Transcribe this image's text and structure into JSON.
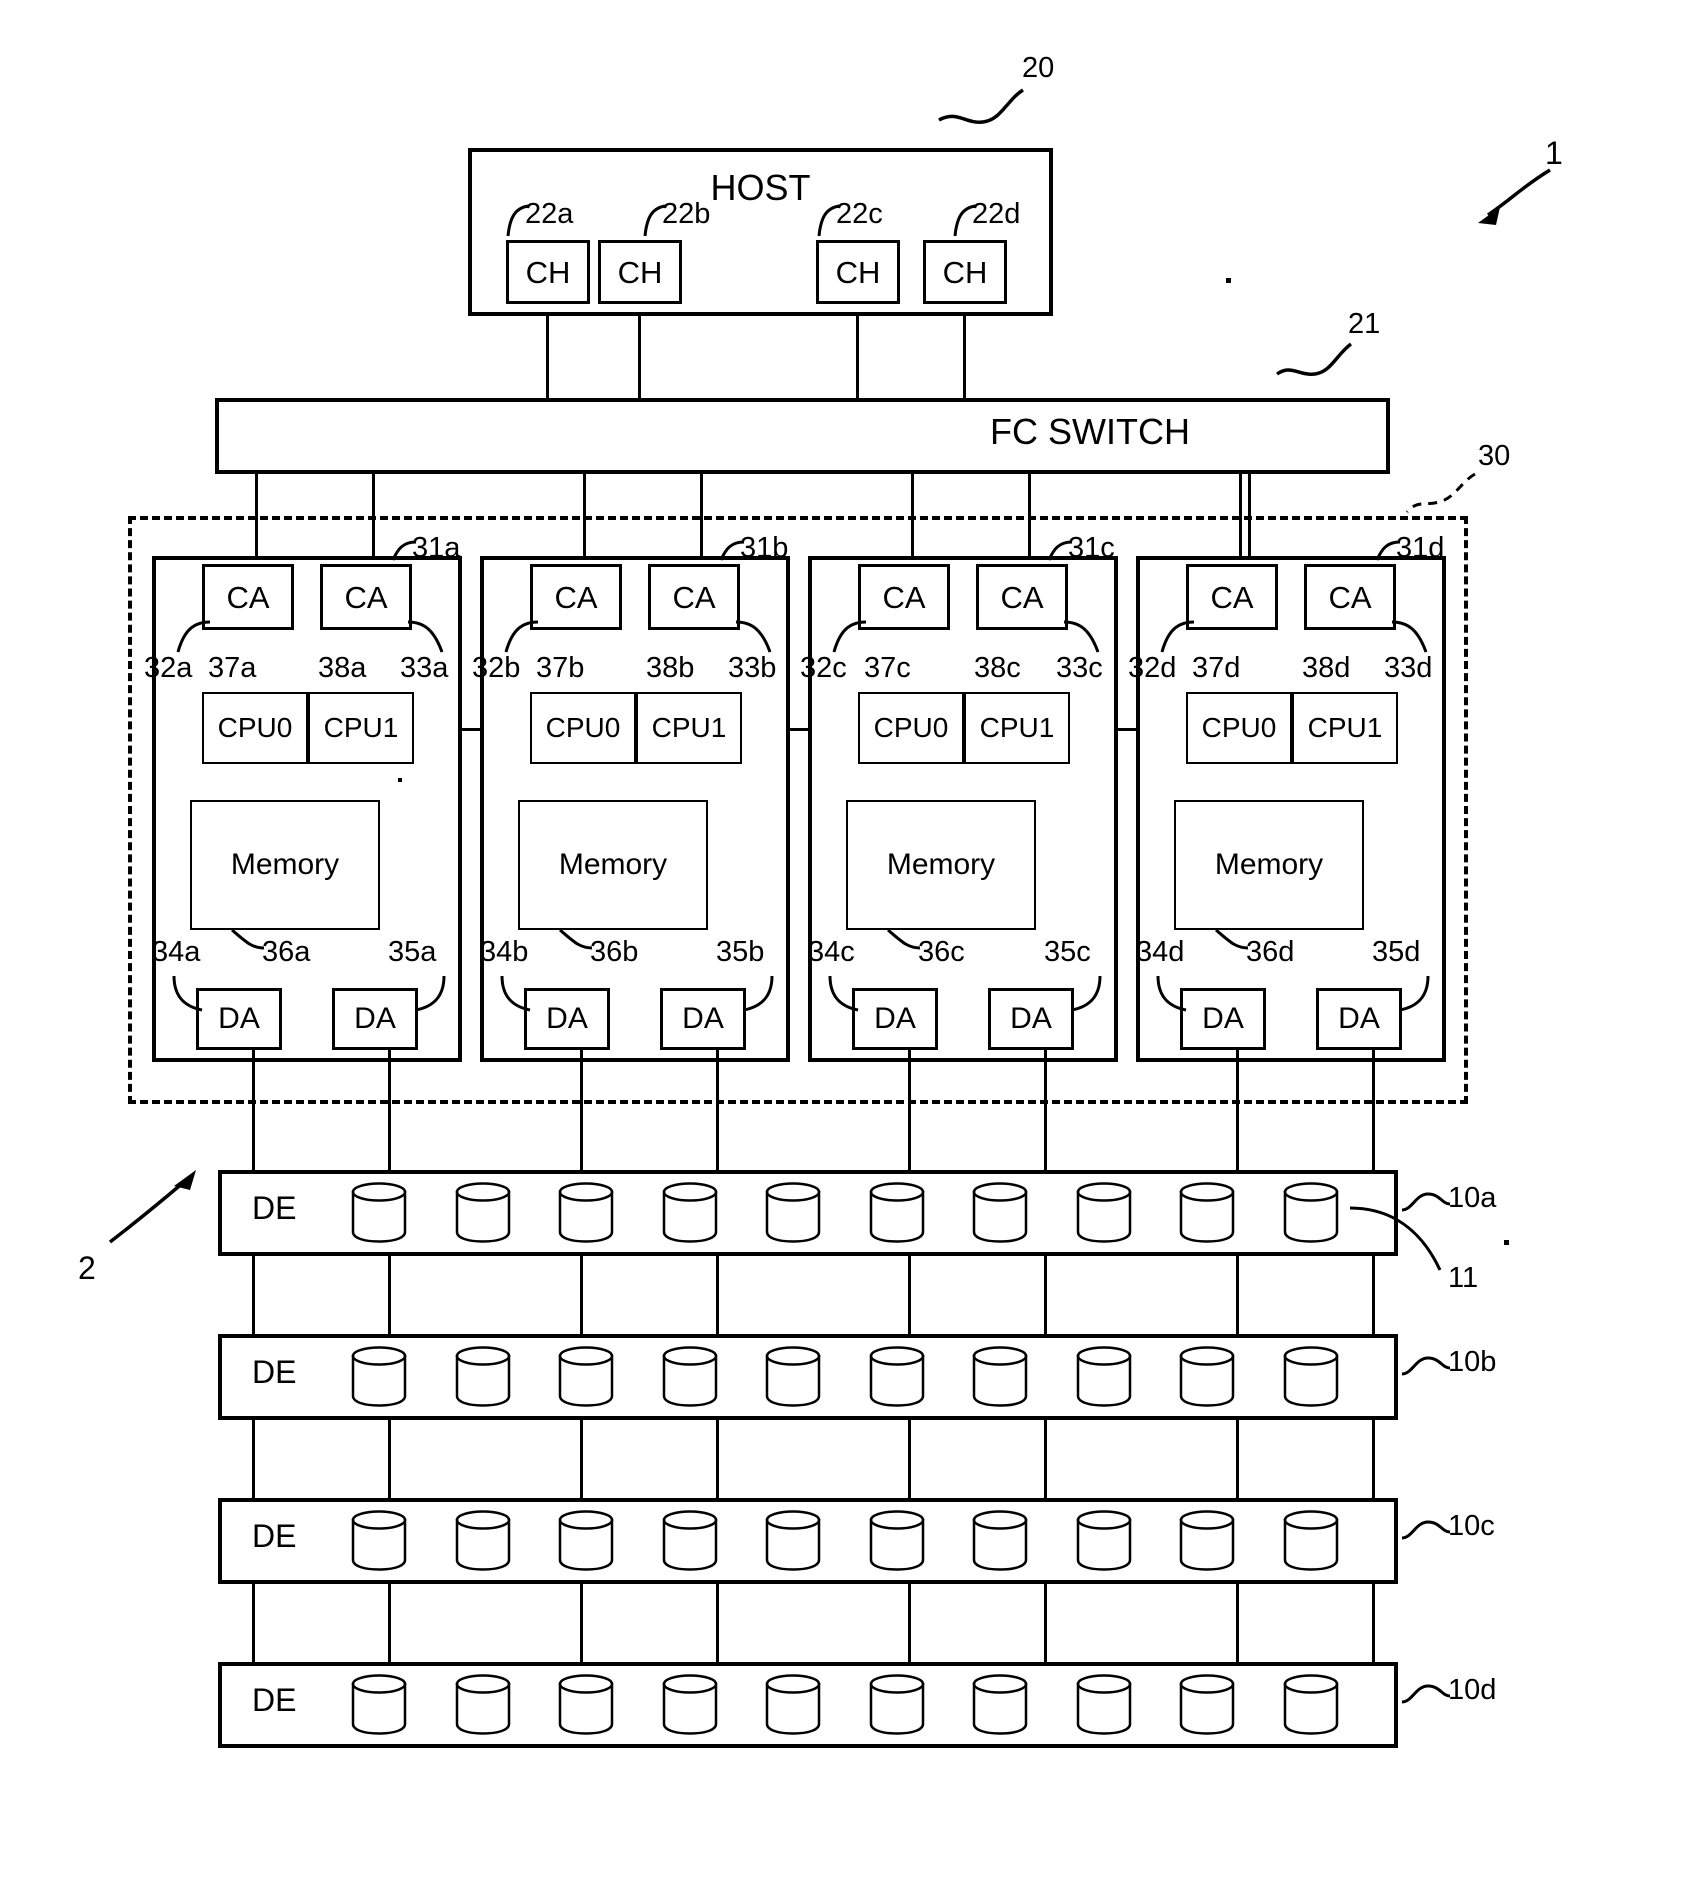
{
  "figure": {
    "system_ref": "1",
    "storage_ref": "2",
    "host": {
      "label": "HOST",
      "ref": "20",
      "channels": [
        {
          "label": "CH",
          "ref": "22a"
        },
        {
          "label": "CH",
          "ref": "22b"
        },
        {
          "label": "CH",
          "ref": "22c"
        },
        {
          "label": "CH",
          "ref": "22d"
        }
      ]
    },
    "switch": {
      "label": "FC SWITCH",
      "ref": "21"
    },
    "controller_group": {
      "ref": "30",
      "modules": [
        {
          "ref": "31a",
          "ca_left": {
            "label": "CA",
            "ref": "32a"
          },
          "ca_right": {
            "label": "CA",
            "ref": "33a"
          },
          "cpu0": {
            "label": "CPU0",
            "ref": "37a"
          },
          "cpu1": {
            "label": "CPU1",
            "ref": "38a"
          },
          "memory": {
            "label": "Memory",
            "ref": "36a"
          },
          "da_left": {
            "label": "DA",
            "ref": "34a"
          },
          "da_right": {
            "label": "DA",
            "ref": "35a"
          }
        },
        {
          "ref": "31b",
          "ca_left": {
            "label": "CA",
            "ref": "32b"
          },
          "ca_right": {
            "label": "CA",
            "ref": "33b"
          },
          "cpu0": {
            "label": "CPU0",
            "ref": "37b"
          },
          "cpu1": {
            "label": "CPU1",
            "ref": "38b"
          },
          "memory": {
            "label": "Memory",
            "ref": "36b"
          },
          "da_left": {
            "label": "DA",
            "ref": "34b"
          },
          "da_right": {
            "label": "DA",
            "ref": "35b"
          }
        },
        {
          "ref": "31c",
          "ca_left": {
            "label": "CA",
            "ref": "32c"
          },
          "ca_right": {
            "label": "CA",
            "ref": "33c"
          },
          "cpu0": {
            "label": "CPU0",
            "ref": "37c"
          },
          "cpu1": {
            "label": "CPU1",
            "ref": "38c"
          },
          "memory": {
            "label": "Memory",
            "ref": "36c"
          },
          "da_left": {
            "label": "DA",
            "ref": "34c"
          },
          "da_right": {
            "label": "DA",
            "ref": "35c"
          }
        },
        {
          "ref": "31d",
          "ca_left": {
            "label": "CA",
            "ref": "32d"
          },
          "ca_right": {
            "label": "CA",
            "ref": "33d"
          },
          "cpu0": {
            "label": "CPU0",
            "ref": "37d"
          },
          "cpu1": {
            "label": "CPU1",
            "ref": "38d"
          },
          "memory": {
            "label": "Memory",
            "ref": "36d"
          },
          "da_left": {
            "label": "DA",
            "ref": "34d"
          },
          "da_right": {
            "label": "DA",
            "ref": "35d"
          }
        }
      ]
    },
    "drive_enclosures": [
      {
        "label": "DE",
        "ref": "10a",
        "disk_count": 10,
        "disk_ref": "11"
      },
      {
        "label": "DE",
        "ref": "10b",
        "disk_count": 10
      },
      {
        "label": "DE",
        "ref": "10c",
        "disk_count": 10
      },
      {
        "label": "DE",
        "ref": "10d",
        "disk_count": 10
      }
    ]
  }
}
